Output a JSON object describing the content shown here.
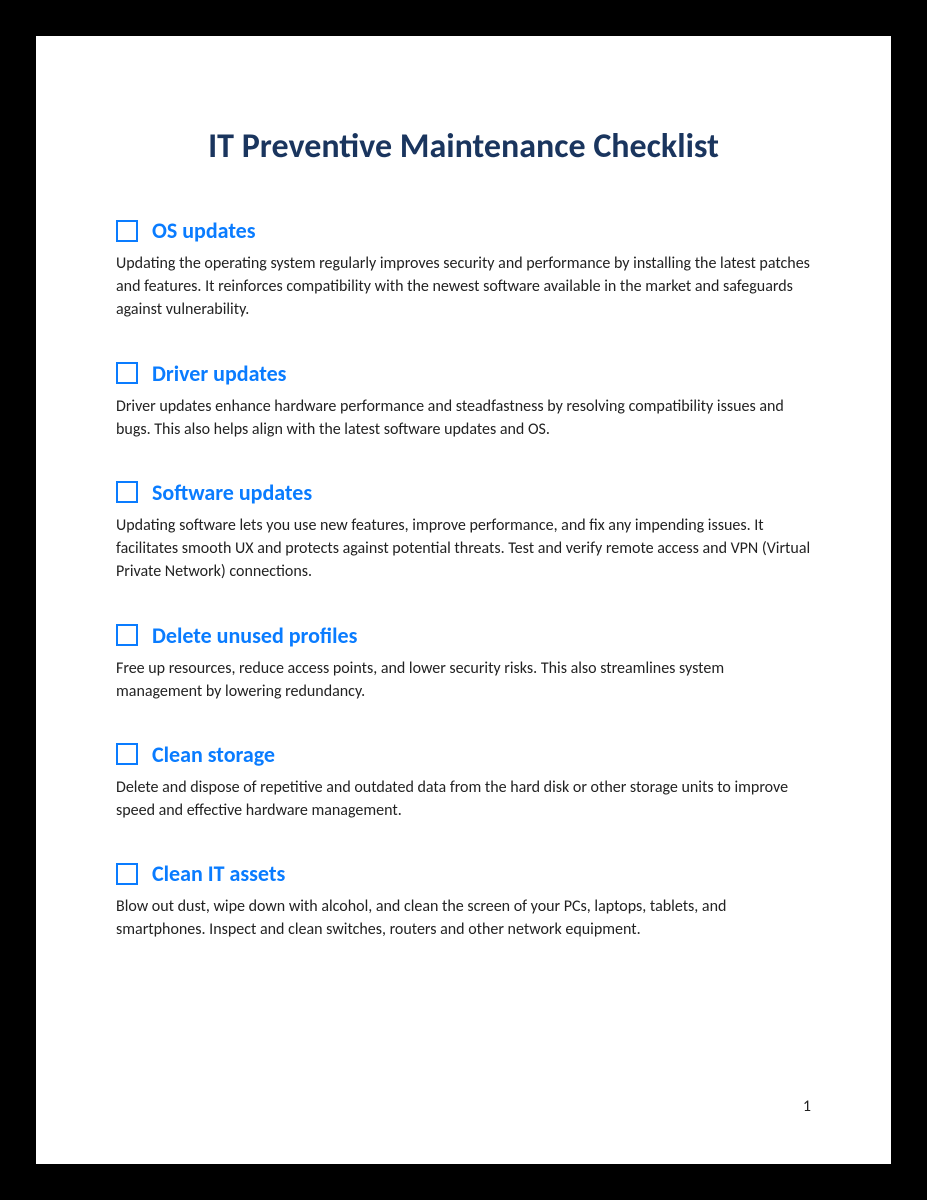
{
  "title": "IT Preventive Maintenance Checklist",
  "items": [
    {
      "title": "OS updates",
      "description": "Updating the operating system regularly improves security and performance by installing the latest patches and features. It reinforces compatibility with the newest software available in the market and safeguards against vulnerability."
    },
    {
      "title": "Driver updates",
      "description": "Driver updates enhance hardware performance and steadfastness by resolving compatibility issues and bugs. This also helps align with the latest software updates and OS."
    },
    {
      "title": "Software updates",
      "description": "Updating software lets you use new features, improve performance, and fix any impending issues. It facilitates smooth UX and protects against potential threats. Test and verify remote access and VPN (Virtual Private Network) connections."
    },
    {
      "title": "Delete unused profiles",
      "description": "Free up resources, reduce access points, and lower security risks. This also streamlines system management by lowering redundancy."
    },
    {
      "title": "Clean storage",
      "description": "Delete and dispose of repetitive and outdated data from the hard disk or other storage units to improve speed and effective hardware management."
    },
    {
      "title": "Clean IT assets",
      "description": "Blow out dust, wipe down with alcohol, and clean the screen of your PCs, laptops, tablets, and smartphones. Inspect and clean switches, routers and other network equipment."
    }
  ],
  "page_number": "1"
}
